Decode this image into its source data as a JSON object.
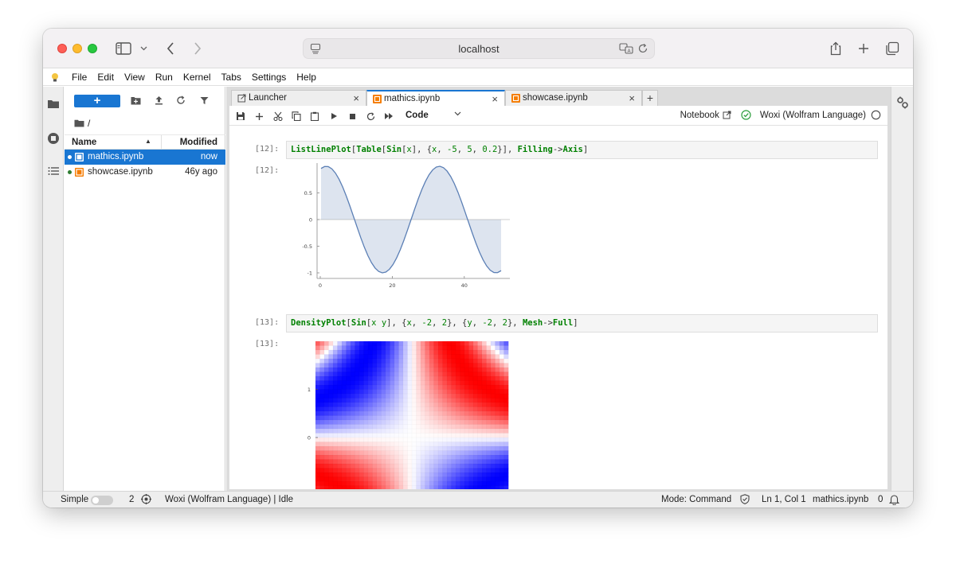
{
  "browser": {
    "url": "localhost"
  },
  "menu": [
    "File",
    "Edit",
    "View",
    "Run",
    "Kernel",
    "Tabs",
    "Settings",
    "Help"
  ],
  "filebrowser": {
    "new_label": "+",
    "path": "/",
    "col_name": "Name",
    "col_modified": "Modified",
    "files": [
      {
        "name": "mathics.ipynb",
        "modified": "now",
        "selected": true
      },
      {
        "name": "showcase.ipynb",
        "modified": "46y ago",
        "selected": false
      }
    ]
  },
  "tabs": [
    {
      "label": "Launcher",
      "active": false
    },
    {
      "label": "mathics.ipynb",
      "active": true
    },
    {
      "label": "showcase.ipynb",
      "active": false
    }
  ],
  "notebook": {
    "cell_type": "Code",
    "mode_label": "Notebook",
    "kernel_name": "Woxi (Wolfram Language)"
  },
  "cells": [
    {
      "in_prompt": "[12]:",
      "out_prompt": "[12]:",
      "code_tokens": [
        {
          "t": "ListLinePlot",
          "c": "k"
        },
        {
          "t": "[",
          "c": "p"
        },
        {
          "t": "Table",
          "c": "k"
        },
        {
          "t": "[",
          "c": "p"
        },
        {
          "t": "Sin",
          "c": "k"
        },
        {
          "t": "[",
          "c": "p"
        },
        {
          "t": "x",
          "c": "n"
        },
        {
          "t": "], {",
          "c": "p"
        },
        {
          "t": "x",
          "c": "n"
        },
        {
          "t": ", ",
          "c": "p"
        },
        {
          "t": "-5",
          "c": "n"
        },
        {
          "t": ", ",
          "c": "p"
        },
        {
          "t": "5",
          "c": "n"
        },
        {
          "t": ", ",
          "c": "p"
        },
        {
          "t": "0.2",
          "c": "n"
        },
        {
          "t": "}], ",
          "c": "p"
        },
        {
          "t": "Filling",
          "c": "k"
        },
        {
          "t": "->",
          "c": "p"
        },
        {
          "t": "Axis",
          "c": "k"
        },
        {
          "t": "]",
          "c": "p"
        }
      ]
    },
    {
      "in_prompt": "[13]:",
      "out_prompt": "[13]:",
      "code_tokens": [
        {
          "t": "DensityPlot",
          "c": "k"
        },
        {
          "t": "[",
          "c": "p"
        },
        {
          "t": "Sin",
          "c": "k"
        },
        {
          "t": "[",
          "c": "p"
        },
        {
          "t": "x y",
          "c": "n"
        },
        {
          "t": "], {",
          "c": "p"
        },
        {
          "t": "x",
          "c": "n"
        },
        {
          "t": ", ",
          "c": "p"
        },
        {
          "t": "-2",
          "c": "n"
        },
        {
          "t": ", ",
          "c": "p"
        },
        {
          "t": "2",
          "c": "n"
        },
        {
          "t": "}, {",
          "c": "p"
        },
        {
          "t": "y",
          "c": "n"
        },
        {
          "t": ", ",
          "c": "p"
        },
        {
          "t": "-2",
          "c": "n"
        },
        {
          "t": ", ",
          "c": "p"
        },
        {
          "t": "2",
          "c": "n"
        },
        {
          "t": "}, ",
          "c": "p"
        },
        {
          "t": "Mesh",
          "c": "k"
        },
        {
          "t": "->",
          "c": "p"
        },
        {
          "t": "Full",
          "c": "k"
        },
        {
          "t": "]",
          "c": "p"
        }
      ]
    }
  ],
  "plot1": {
    "x_ticks": [
      "0",
      "20",
      "40"
    ],
    "y_ticks": [
      "0.5",
      "0",
      "-0.5",
      "-1"
    ],
    "line_color": "#5b7fb5",
    "fill_color": "#dde4ef"
  },
  "plot2": {
    "y_ticks": [
      "1",
      "0"
    ],
    "pos_color": "#ff0000",
    "neg_color": "#0000ff"
  },
  "status": {
    "mode_toggle": "Simple",
    "kernel_count": "2",
    "kernel_status": "Woxi (Wolfram Language) | Idle",
    "command_mode": "Mode: Command",
    "cursor": "Ln 1, Col 1",
    "filename": "mathics.ipynb",
    "notifications": "0"
  }
}
